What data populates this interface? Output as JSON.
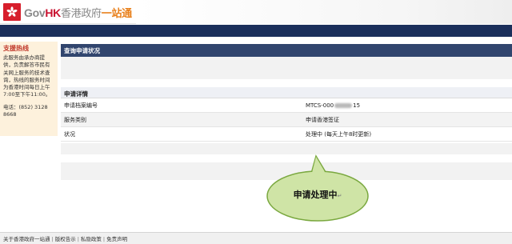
{
  "header": {
    "logo_gov": "Gov",
    "logo_hk": "HK",
    "logo_cn": "香港政府",
    "logo_accent": "一站通"
  },
  "sidebar": {
    "title": "支援热线",
    "text": "此服务由承办商提供，负责解答市民有关网上服务的技术查询，热线的服务时间为香港时间每日上午7:00至下午11:00。",
    "phone": "电话：(852) 3128 8668"
  },
  "main": {
    "panel_title": "查询申请状况",
    "details_heading": "申请详情",
    "rows": [
      {
        "key": "申请档案编号",
        "value_prefix": "MTCS-000",
        "value_suffix": "15"
      },
      {
        "key": "服务类别",
        "value": "申请香港签证"
      },
      {
        "key": "状况",
        "value": "处理中 (每天上午8时更新)"
      }
    ]
  },
  "bubble": {
    "label": "申请处理中",
    "mark": "↵",
    "fill": "#cfe4a6",
    "stroke": "#7aa83f"
  },
  "footer": {
    "links": [
      "关于香港政府一站通",
      "版权告示",
      "私隐政策",
      "免责声明"
    ]
  },
  "colors": {
    "nav": "#1b2f5b",
    "panel_title": "#31456e",
    "sidebar_bg": "#fdf1dc",
    "brand_red": "#c8102e"
  }
}
